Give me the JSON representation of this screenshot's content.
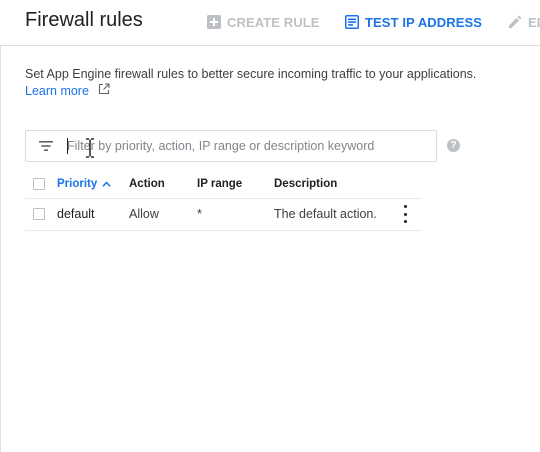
{
  "header": {
    "title": "Firewall rules",
    "create_rule_label": "CREATE RULE",
    "test_ip_label": "TEST IP ADDRESS",
    "edit_label": "ED"
  },
  "intro": {
    "description": "Set App Engine firewall rules to better secure incoming traffic to your applications.",
    "learn_more": "Learn more"
  },
  "filter": {
    "value": "",
    "placeholder": "Filter by priority, action, IP range or description keyword"
  },
  "table": {
    "columns": [
      "Priority",
      "Action",
      "IP range",
      "Description"
    ],
    "sorted_column": "Priority",
    "rows": [
      {
        "priority": "default",
        "action": "Allow",
        "ip_range": "*",
        "description": "The default action."
      }
    ]
  },
  "colors": {
    "accent": "#1a73e8",
    "disabled": "#bdc1c6",
    "divider": "#dadce0"
  },
  "icons": [
    "add-box-icon",
    "test-ip-icon",
    "edit-icon",
    "external-link-icon",
    "filter-icon",
    "help-icon",
    "sort-up-icon",
    "more-vert-icon",
    "text-cursor-icon"
  ]
}
